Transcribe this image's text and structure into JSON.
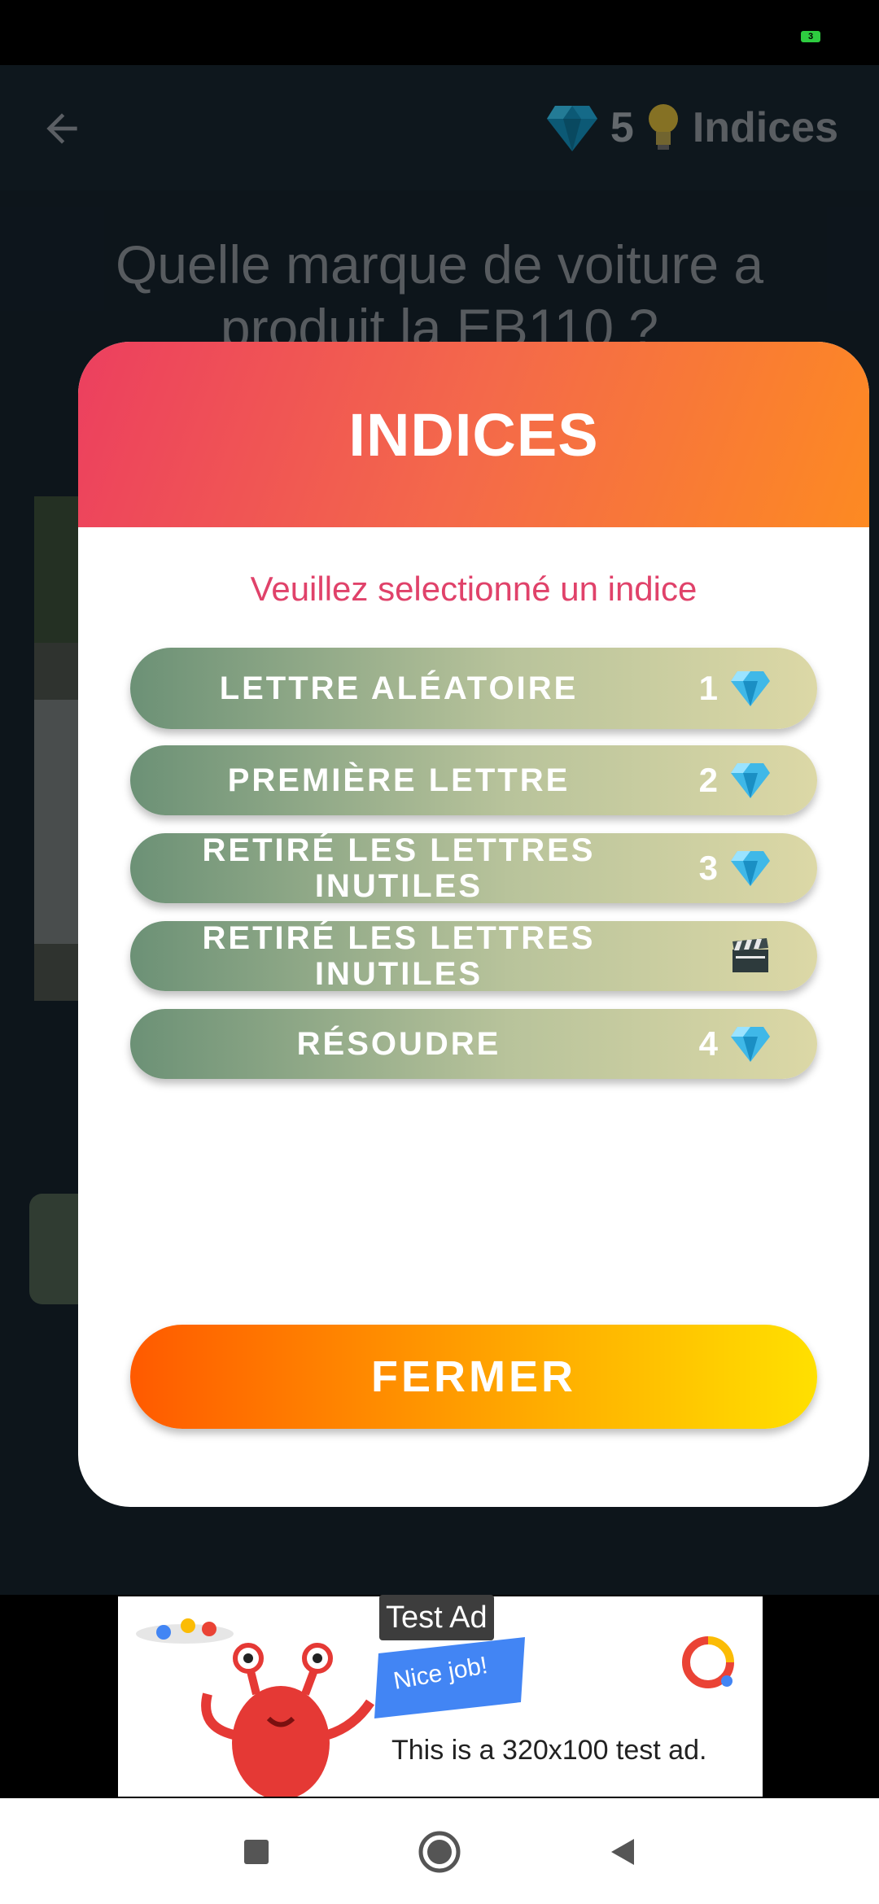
{
  "app_bar": {
    "gem_count": "5",
    "hints_label": "Indices"
  },
  "question": "Quelle marque de voiture a produit la EB110 ?",
  "dialog": {
    "title": "INDICES",
    "subtitle": "Veuillez selectionné un indice",
    "options": [
      {
        "label": "LETTRE ALÉATOIRE",
        "cost": "1",
        "icon": "diamond-icon"
      },
      {
        "label": "PREMIÈRE LETTRE",
        "cost": "2",
        "icon": "diamond-icon"
      },
      {
        "label": "RETIRÉ LES LETTRES INUTILES",
        "cost": "3",
        "icon": "diamond-icon"
      },
      {
        "label": "RETIRÉ LES LETTRES INUTILES",
        "cost": "",
        "icon": "clapperboard-icon"
      },
      {
        "label": "RÉSOUDRE",
        "cost": "4",
        "icon": "diamond-icon"
      }
    ],
    "close_label": "FERMER"
  },
  "ad": {
    "tag": "Test Ad",
    "flag_text": "Nice job!",
    "text": "This is a 320x100 test ad."
  },
  "status": {
    "battery": "3"
  },
  "colors": {
    "header_gradient": [
      "#ec3f5f",
      "#fd8a22"
    ],
    "option_gradient": [
      "#6c9176",
      "#dcd8a6"
    ],
    "close_gradient": [
      "#ff5a00",
      "#ffe000"
    ],
    "subtitle": "#e0426a"
  }
}
